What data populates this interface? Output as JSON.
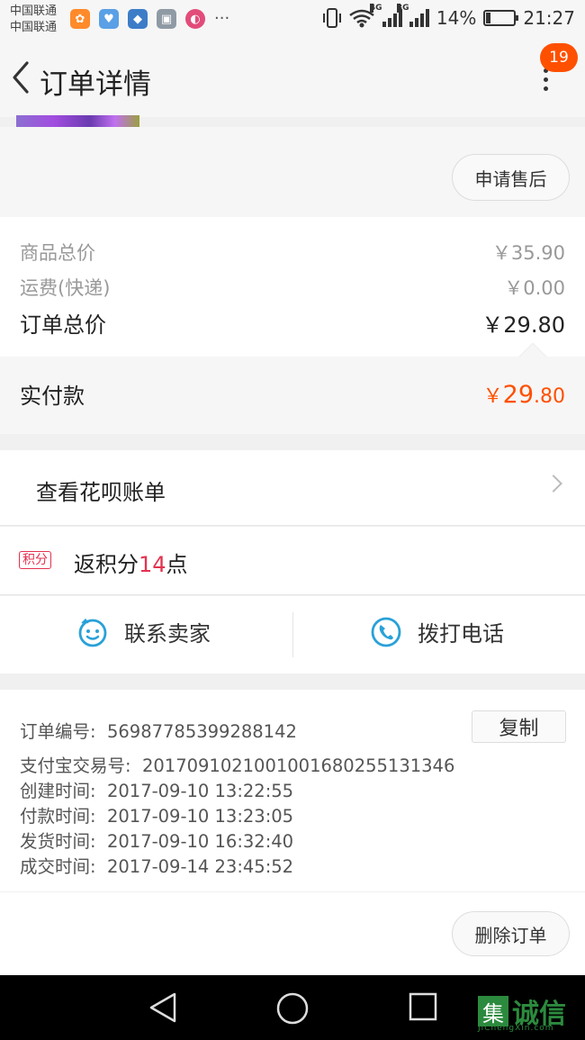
{
  "status_bar": {
    "carrier_1": "中国联通",
    "carrier_2": "中国联通",
    "more": "···",
    "net_1": "4G",
    "net_2": "3G",
    "battery": "14%",
    "battery_level": 0.14,
    "time": "21:27"
  },
  "header": {
    "title": "订单详情",
    "badge": "19"
  },
  "after_sale": {
    "label": "申请售后"
  },
  "price": {
    "goods_label": "商品总价",
    "goods_value": "￥35.90",
    "shipping_label": "运费(快递)",
    "shipping_value": "￥0.00",
    "total_label": "订单总价",
    "total_value": "￥29.80",
    "paid_label": "实付款",
    "paid_symbol": "￥",
    "paid_int": "29",
    "paid_dec": ".80"
  },
  "huabei": {
    "label": "查看花呗账单"
  },
  "points": {
    "tag": "积分",
    "prefix": "返积分",
    "number": "14",
    "suffix": "点"
  },
  "contact": {
    "seller": "联系卖家",
    "phone": "拨打电话"
  },
  "info": {
    "order_no_label": "订单编号:",
    "order_no": "56987785399288142",
    "copy": "复制",
    "alipay_label": "支付宝交易号:",
    "alipay_no": "2017091021001001680255131346",
    "created_label": "创建时间:",
    "created": "2017-09-10 13:22:55",
    "paid_label": "付款时间:",
    "paid": "2017-09-10 13:23:05",
    "shipped_label": "发货时间:",
    "shipped": "2017-09-10 16:32:40",
    "done_label": "成交时间:",
    "done": "2017-09-14 23:45:52"
  },
  "delete": {
    "label": "删除订单"
  },
  "watermark": {
    "mark": "集",
    "text": "诚信",
    "sub": "JiChengXin.com"
  },
  "colors": {
    "accent": "#ff5000",
    "points_red": "#e4324f",
    "link_blue": "#29a1d8"
  }
}
